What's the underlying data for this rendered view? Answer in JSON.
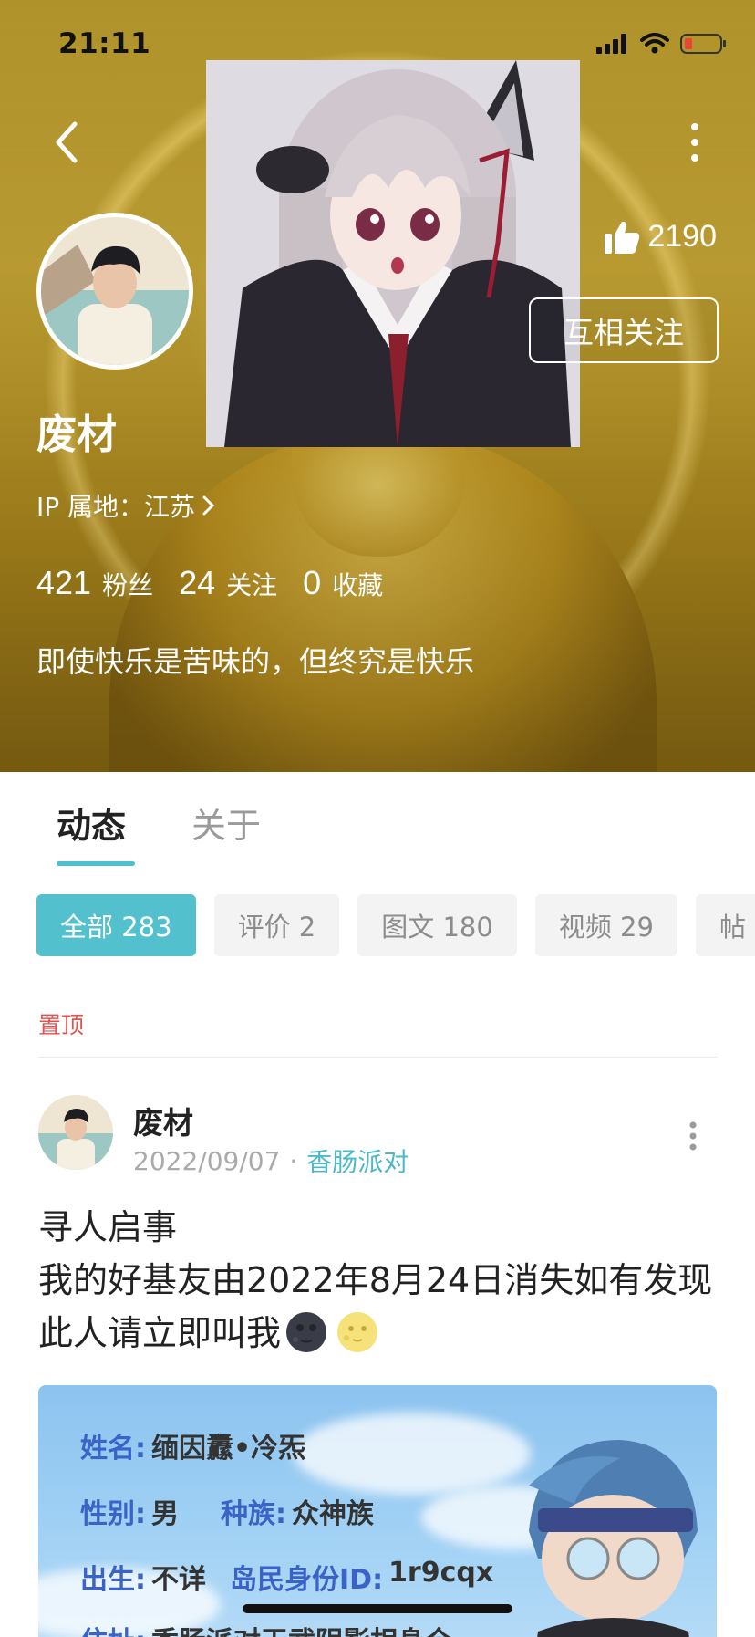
{
  "status_bar": {
    "time": "21:11"
  },
  "profile": {
    "likes": "2190",
    "follow_button": "互相关注",
    "nickname": "废材",
    "ip_label": "IP 属地：江苏",
    "stats": [
      {
        "value": "421",
        "label": "粉丝"
      },
      {
        "value": "24",
        "label": "关注"
      },
      {
        "value": "0",
        "label": "收藏"
      }
    ],
    "bio": "即使快乐是苦味的，但终究是快乐"
  },
  "tabs": [
    {
      "label": "动态",
      "active": true
    },
    {
      "label": "关于",
      "active": false
    }
  ],
  "filters": [
    {
      "label": "全部 283",
      "active": true
    },
    {
      "label": "评价 2",
      "active": false
    },
    {
      "label": "图文 180",
      "active": false
    },
    {
      "label": "视频 29",
      "active": false
    },
    {
      "label": "帖",
      "active": false
    }
  ],
  "pinned_label": "置顶",
  "post": {
    "author": "废材",
    "date": "2022/09/07",
    "separator": "·",
    "topic": "香肠派对",
    "text_line1": "寻人启事",
    "text_line2": "我的好基友由2022年8月24日消失如有发现此人请立即叫我",
    "emojis": [
      "new-moon-face-icon",
      "full-moon-face-icon"
    ],
    "image_card": {
      "rows": [
        {
          "key": "姓名:",
          "value": "缅因纛•冷炁"
        },
        {
          "key": "性别:",
          "value": "男",
          "key2": "种族:",
          "value2": "众神族"
        },
        {
          "key": "出生:",
          "value": "不详",
          "key2": "岛民身份ID:",
          "value2": "1r9cqx"
        },
        {
          "key": "住址:",
          "value": "香肠派对天武阴影相身仓"
        }
      ]
    }
  },
  "colors": {
    "accent": "#52c0cd",
    "pinned": "#e0524f",
    "topic": "#4cb8c8"
  }
}
